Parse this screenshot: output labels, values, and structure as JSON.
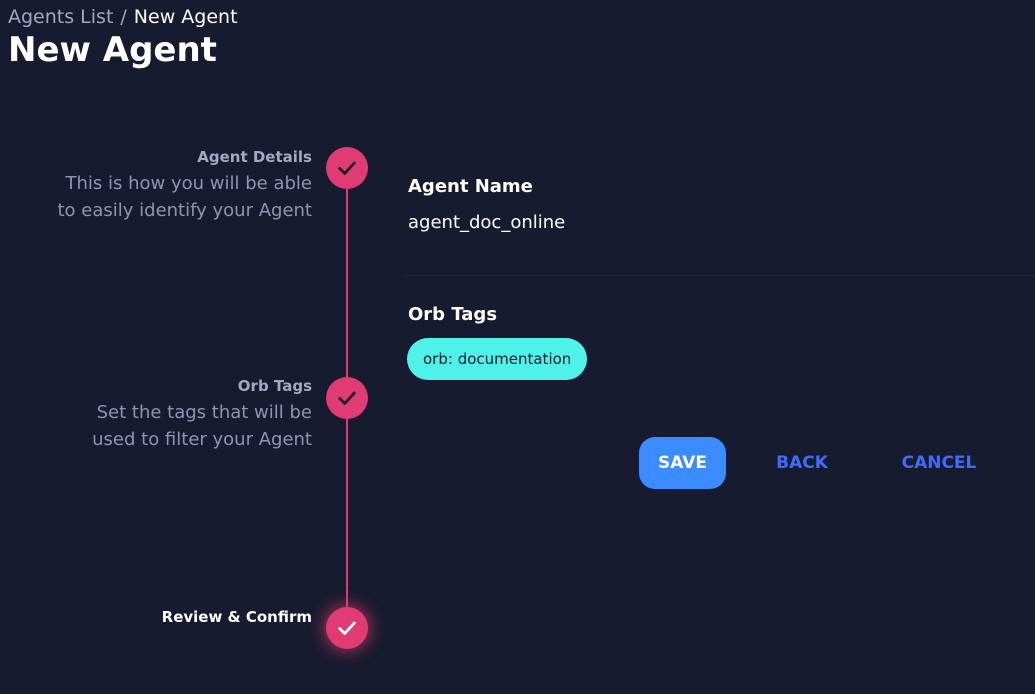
{
  "breadcrumb": {
    "parent": "Agents List",
    "separator": "/",
    "current": "New Agent"
  },
  "page_title": "New Agent",
  "steps": [
    {
      "title": "Agent Details",
      "desc_line1": "This is how you will be able",
      "desc_line2": "to easily identify your Agent",
      "status": "complete"
    },
    {
      "title": "Orb Tags",
      "desc_line1": "Set the tags that will be",
      "desc_line2": "used to filter your Agent",
      "status": "complete"
    },
    {
      "title": "Review & Confirm",
      "status": "active"
    }
  ],
  "review": {
    "agent_name_label": "Agent Name",
    "agent_name_value": "agent_doc_online",
    "orb_tags_label": "Orb Tags",
    "tags": [
      "orb: documentation"
    ]
  },
  "buttons": {
    "save": "SAVE",
    "back": "BACK",
    "cancel": "CANCEL"
  },
  "icons": {
    "step_icon": "check-icon"
  },
  "colors": {
    "background": "#171b2f",
    "accent": "#e03b72",
    "tag": "#4ef2e8",
    "primary_button": "#3b8cff",
    "link_button": "#3d6cff"
  }
}
